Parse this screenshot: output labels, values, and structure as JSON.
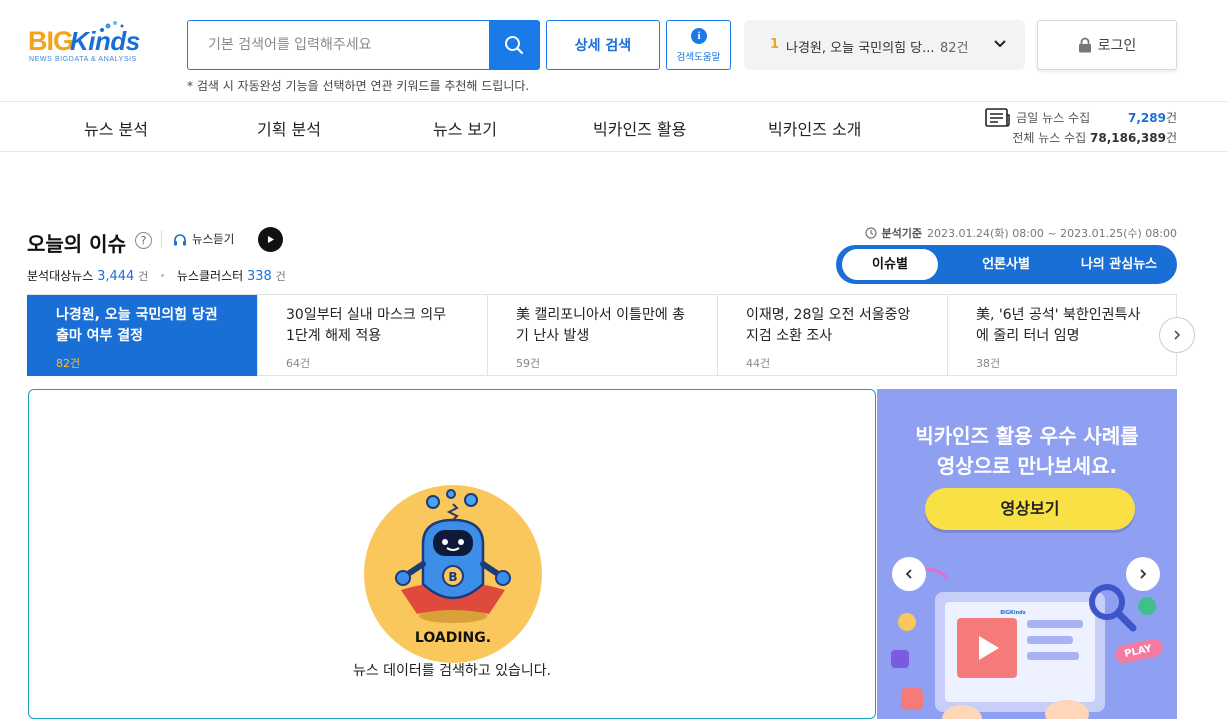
{
  "logo": {
    "big": "BIG",
    "kinds": "Kinds",
    "tagline": "NEWS BIGDATA & ANALYSIS"
  },
  "search": {
    "placeholder": "기본 검색어를 입력해주세요",
    "hint": "* 검색 시 자동완성 기능을 선택하면 연관 키워드를 추천해 드립니다."
  },
  "header": {
    "detail_search_label": "상세 검색",
    "help_label": "검색도움말",
    "top_issue": {
      "rank": "1",
      "text": "나경원, 오늘 국민의힘 당...",
      "count": "82건"
    },
    "login_label": "로그인"
  },
  "nav": {
    "items": [
      "뉴스 분석",
      "기획 분석",
      "뉴스 보기",
      "빅카인즈 활용",
      "빅카인즈 소개"
    ]
  },
  "stats": {
    "today_label": "금일 뉴스 수집",
    "today_value": "7,289",
    "unit": "건",
    "total_label": "전체 뉴스 수집",
    "total_value": "78,186,389"
  },
  "today_issue": {
    "title": "오늘의 이슈",
    "listen_label": "뉴스듣기",
    "analyzed_label": "분석대상뉴스",
    "analyzed_value": "3,444",
    "analyzed_unit": "건",
    "cluster_label": "뉴스클러스터",
    "cluster_value": "338",
    "cluster_unit": "건",
    "basis_label": "분석기준",
    "basis_value": "2023.01.24(화) 08:00 ~ 2023.01.25(수) 08:00",
    "tabs": [
      "이슈별",
      "언론사별",
      "나의 관심뉴스"
    ],
    "active_tab": 0,
    "issues": [
      {
        "title": "나경원, 오늘 국민의힘 당권 출마 여부 결정",
        "count": "82건"
      },
      {
        "title": "30일부터 실내 마스크 의무 1단계 해제 적용",
        "count": "64건"
      },
      {
        "title": "美 캘리포니아서 이틀만에 총기 난사 발생",
        "count": "59건"
      },
      {
        "title": "이재명, 28일 오전 서울중앙지검 소환 조사",
        "count": "44건"
      },
      {
        "title": "美, '6년 공석' 북한인권특사에 줄리 터너 임명",
        "count": "38건"
      }
    ],
    "active_issue": 0
  },
  "loading": {
    "badge": "LOADING.",
    "badge_letter": "B",
    "message": "뉴스 데이터를 검색하고 있습니다."
  },
  "banner": {
    "headline_line1": "빅카인즈 활용 우수 사례를",
    "headline_line2": "영상으로 만나보세요.",
    "cta": "영상보기",
    "art_mini_logo": "BIGKinds",
    "art_play_label": "PLAY"
  },
  "colors": {
    "primary": "#1a6fd6",
    "accent": "#f2a41c",
    "banner_bg": "#8f9ff2",
    "cta": "#f8e045",
    "loading_bg": "#f9c75b"
  }
}
